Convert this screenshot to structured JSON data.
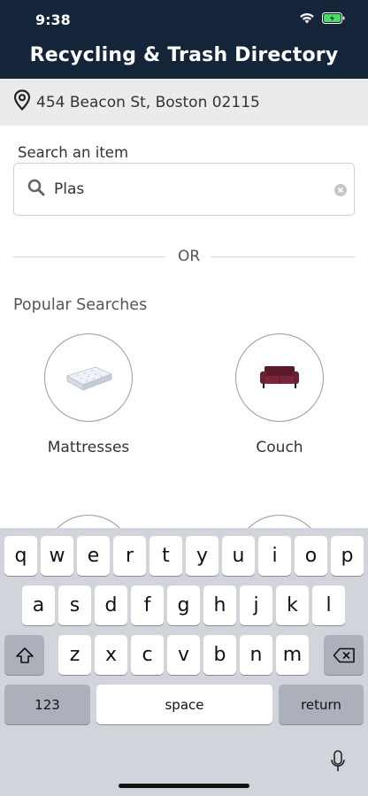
{
  "status_bar": {
    "time": "9:38"
  },
  "header": {
    "title": "Recycling & Trash Directory"
  },
  "location": {
    "address": "454 Beacon St, Boston 02115"
  },
  "search": {
    "label": "Search an item",
    "value": "Plas"
  },
  "divider": {
    "text": "OR"
  },
  "popular": {
    "title": "Popular Searches",
    "items": [
      {
        "label": "Mattresses",
        "icon": "mattress"
      },
      {
        "label": "Couch",
        "icon": "couch"
      }
    ]
  },
  "keyboard": {
    "row1": [
      "q",
      "w",
      "e",
      "r",
      "t",
      "y",
      "u",
      "i",
      "o",
      "p"
    ],
    "row2": [
      "a",
      "s",
      "d",
      "f",
      "g",
      "h",
      "j",
      "k",
      "l"
    ],
    "row3": [
      "z",
      "x",
      "c",
      "v",
      "b",
      "n",
      "m"
    ],
    "numbers_key": "123",
    "space_key": "space",
    "return_key": "return",
    "icons": [
      "shift-icon",
      "backspace-icon",
      "microphone-icon"
    ]
  }
}
